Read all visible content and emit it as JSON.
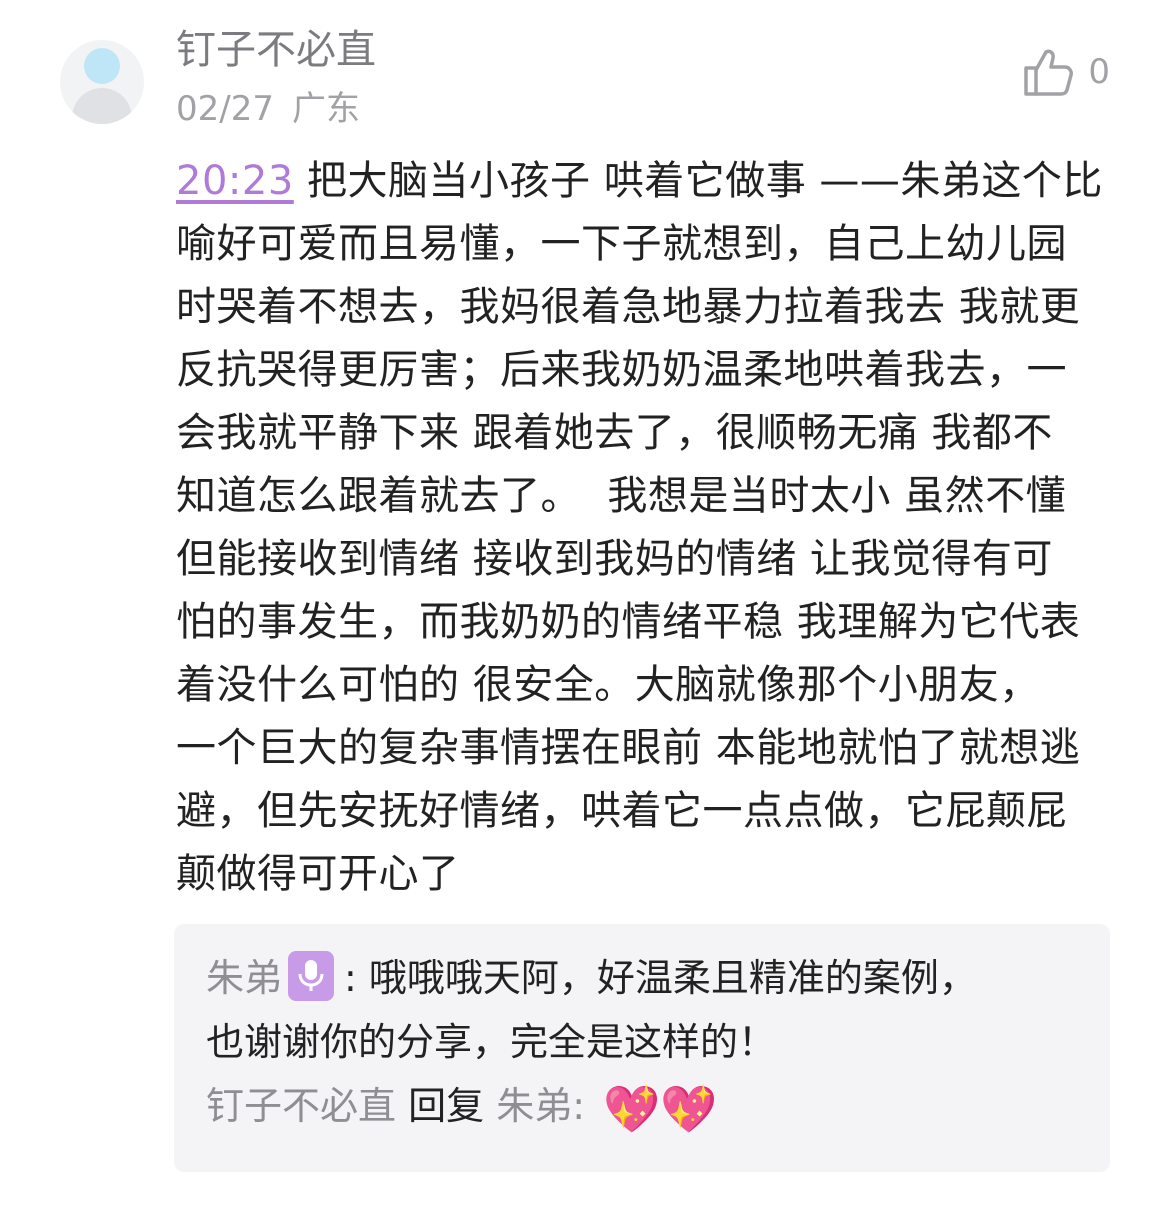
{
  "comment": {
    "username": "钉子不必直",
    "date": "02/27",
    "region": "广东",
    "like_count": "0",
    "timestamp_link": "20:23",
    "lines": [
      " 把大脑当小孩子 哄着它做事 ——朱弟这个比",
      "喻好可爱而且易懂，一下子就想到，自己上幼儿园",
      "时哭着不想去，我妈很着急地暴力拉着我去 我就更",
      "反抗哭得更厉害；后来我奶奶温柔地哄着我去，一",
      "会我就平静下来 跟着她去了，很顺畅无痛 我都不",
      "知道怎么跟着就去了。  我想是当时太小 虽然不懂",
      "但能接收到情绪 接收到我妈的情绪 让我觉得有可",
      "怕的事发生，而我奶奶的情绪平稳 我理解为它代表",
      "着没什么可怕的 很安全。大脑就像那个小朋友，",
      "一个巨大的复杂事情摆在眼前 本能地就怕了就想逃",
      "避，但先安抚好情绪，哄着它一点点做，它屁颠屁",
      "颠做得可开心了"
    ]
  },
  "replies": [
    {
      "author": "朱弟",
      "author_badge_icon": "microphone-icon",
      "separator": ": ",
      "text_line1": "哦哦哦天阿，好温柔且精准的案例，",
      "text_line2": "也谢谢你的分享，完全是这样的！"
    },
    {
      "author": "钉子不必直",
      "action": "回复",
      "target": "朱弟",
      "separator": ": ",
      "emoji": "💖💖"
    }
  ],
  "colors": {
    "accent_purple": "#b07ad8",
    "badge_purple": "#c79be8",
    "muted_gray": "#8e8e93",
    "reply_bg": "#f4f4f6"
  }
}
